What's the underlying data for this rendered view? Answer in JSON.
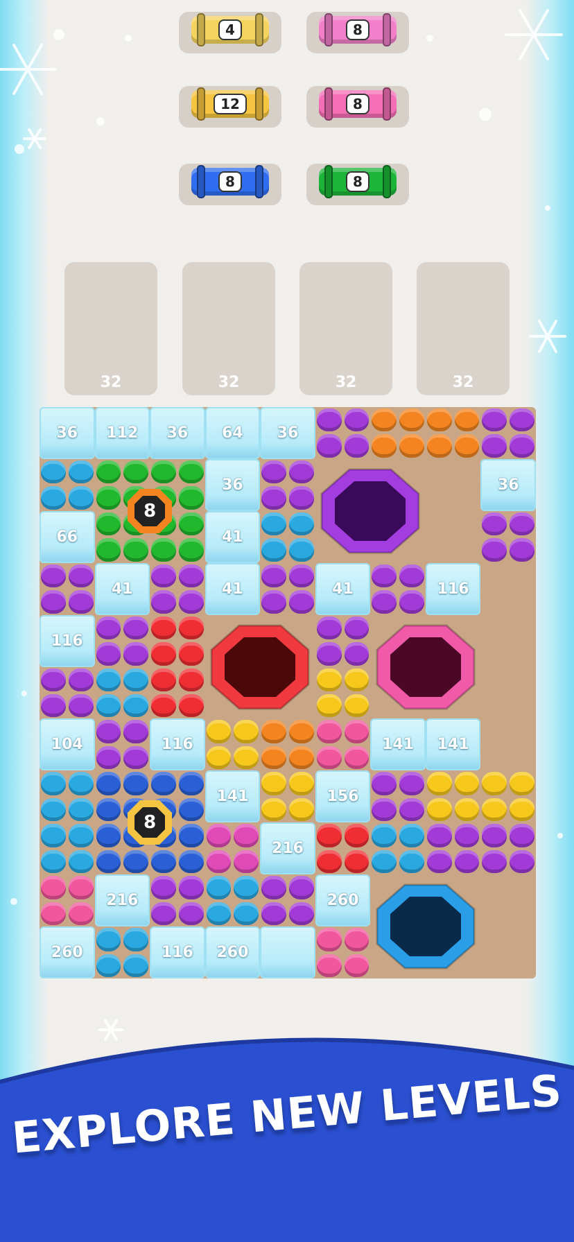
{
  "spools": [
    {
      "value": "4",
      "color": "#f4d35e"
    },
    {
      "value": "8",
      "color": "#f27fc9"
    },
    {
      "value": "12",
      "color": "#f5c542"
    },
    {
      "value": "8",
      "color": "#f46fb6"
    },
    {
      "value": "8",
      "color": "#2f6ef0"
    },
    {
      "value": "8",
      "color": "#1db43a"
    }
  ],
  "trays": [
    "32",
    "32",
    "32",
    "32"
  ],
  "ice_labels": [
    "36",
    "112",
    "36",
    "64",
    "36",
    "36",
    "36",
    "66",
    "41",
    "41",
    "41",
    "41",
    "116",
    "116",
    "104",
    "116",
    "141",
    "141",
    "141",
    "156",
    "216",
    "216",
    "260",
    "260",
    "116",
    "260"
  ],
  "badges": [
    "8",
    "8"
  ],
  "colors": {
    "purple": "#a23ad8",
    "orange": "#f3841f",
    "blue": "#2aa8e0",
    "green": "#22b82e",
    "red": "#ef2e34",
    "yellow": "#f7c81c",
    "pink": "#f0579d",
    "navy": "#2a5fd6",
    "magenta": "#e04ab6"
  },
  "banner": {
    "text": "EXPLORE NEW LEVELS"
  }
}
